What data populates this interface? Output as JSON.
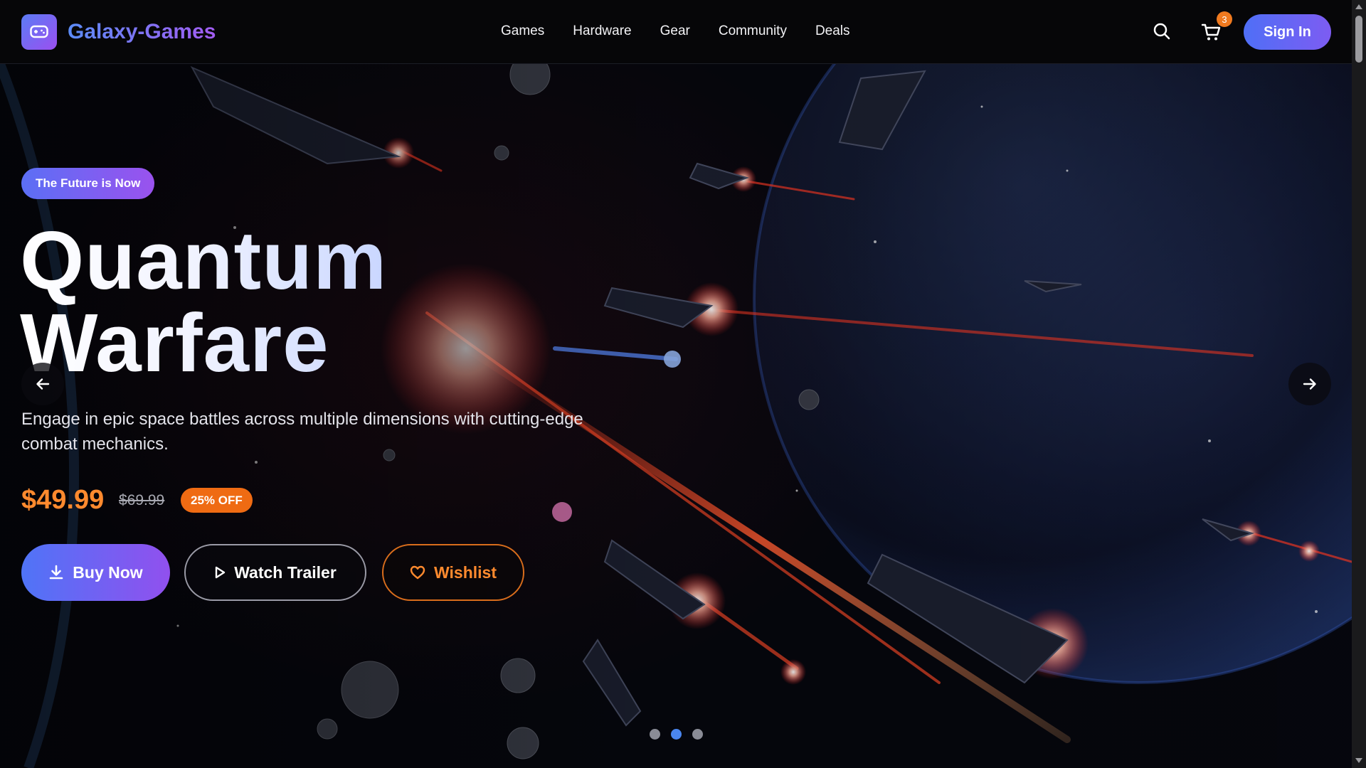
{
  "brand": {
    "name": "Galaxy-Games",
    "icon": "gamepad-icon",
    "gradient": [
      "#5b7cf5",
      "#9b4ff0"
    ]
  },
  "nav": {
    "links": [
      "Games",
      "Hardware",
      "Gear",
      "Community",
      "Deals"
    ],
    "search_icon": "search-icon",
    "cart_icon": "cart-icon",
    "cart_count": "3",
    "sign_in_label": "Sign In"
  },
  "hero": {
    "tag": "The Future is Now",
    "title_line1": "Quantum",
    "title_line2": "Warfare",
    "description": "Engage in epic space battles across multiple dimensions with cutting-edge combat mechanics.",
    "price": "$49.99",
    "old_price": "$69.99",
    "discount": "25% OFF",
    "buttons": {
      "buy": "Buy Now",
      "trailer": "Watch Trailer",
      "wishlist": "Wishlist"
    }
  },
  "carousel": {
    "slides": 3,
    "active_index": 1
  },
  "colors": {
    "accent_orange": "#ff8a2e",
    "accent_blue": "#4f74f7",
    "accent_purple": "#9150ee",
    "dot_active": "#4a86f0"
  }
}
